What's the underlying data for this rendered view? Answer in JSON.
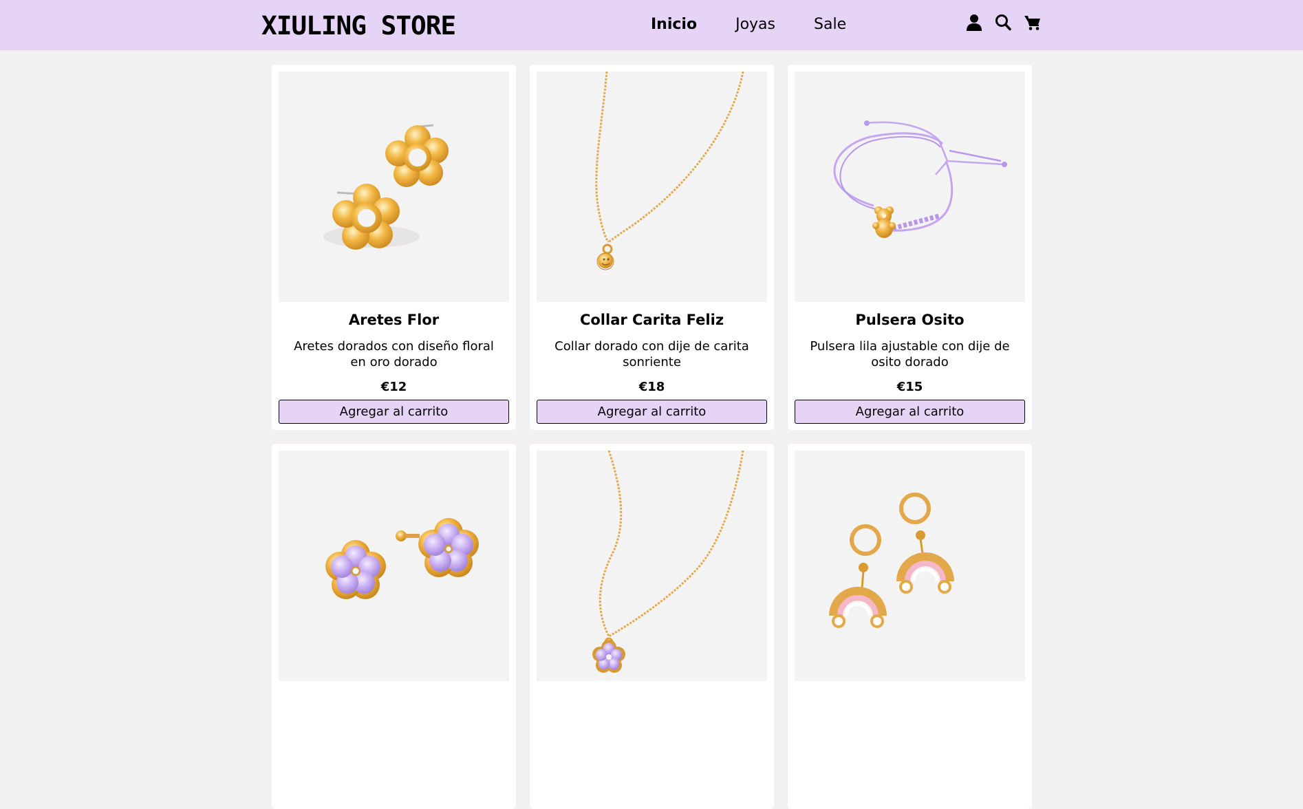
{
  "brand": {
    "logo": "XIULING STORE"
  },
  "nav": {
    "links": [
      {
        "label": "Inicio",
        "active": true
      },
      {
        "label": "Joyas",
        "active": false
      },
      {
        "label": "Sale",
        "active": false
      }
    ],
    "icons": [
      "user-icon",
      "search-icon",
      "cart-icon"
    ]
  },
  "products": [
    {
      "name": "Aretes Flor",
      "description": "Aretes dorados con diseño floral en oro dorado",
      "price": "€12",
      "button": "Agregar al carrito",
      "image": "gold-flower-earrings"
    },
    {
      "name": "Collar Carita Feliz",
      "description": "Collar dorado con dije de carita sonriente",
      "price": "€18",
      "button": "Agregar al carrito",
      "image": "gold-smiley-necklace"
    },
    {
      "name": "Pulsera Osito",
      "description": "Pulsera lila ajustable con dije de osito dorado",
      "price": "€15",
      "button": "Agregar al carrito",
      "image": "lilac-bear-bracelet"
    },
    {
      "image": "lilac-flower-earrings"
    },
    {
      "image": "lilac-flower-necklace"
    },
    {
      "image": "rainbow-hoop-earrings"
    }
  ],
  "colors": {
    "nav_bg": "#e6d4f7",
    "page_bg": "#f2f0f1",
    "card_bg": "#ffffff",
    "gold": "#e8a93b",
    "lilac": "#c2a6ee"
  }
}
